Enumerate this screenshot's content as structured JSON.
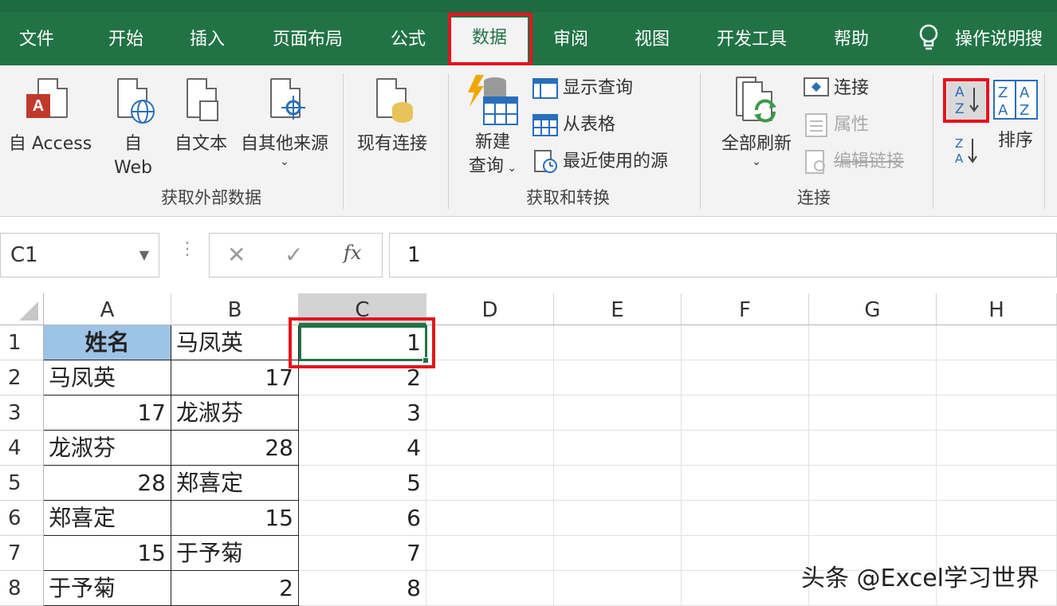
{
  "tabs": [
    "文件",
    "开始",
    "插入",
    "页面布局",
    "公式",
    "数据",
    "审阅",
    "视图",
    "开发工具",
    "帮助"
  ],
  "active_tab": "数据",
  "tell_me": "操作说明搜",
  "ribbon": {
    "from_access": "自 Access",
    "from_web_1": "自",
    "from_web_2": "Web",
    "from_text": "自文本",
    "from_other": "自其他来源",
    "existing_conn": "现有连接",
    "group_get_external": "获取外部数据",
    "new_query_1": "新建",
    "new_query_2": "查询",
    "show_queries": "显示查询",
    "from_table": "从表格",
    "recent_sources": "最近使用的源",
    "group_get_transform": "获取和转换",
    "refresh_all": "全部刷新",
    "connections": "连接",
    "properties": "属性",
    "edit_links": "编辑链接",
    "group_connections": "连接",
    "sort": "排序",
    "sort_asc_icon": "A\nZ",
    "sort_desc_icon": "Z\nA"
  },
  "namebox": "C1",
  "formula_value": "1",
  "columns": [
    "A",
    "B",
    "C",
    "D",
    "E",
    "F",
    "G",
    "H"
  ],
  "rows": [
    "1",
    "2",
    "3",
    "4",
    "5",
    "6",
    "7",
    "8"
  ],
  "cells": {
    "A1": "姓名",
    "B1": "马凤英",
    "C1": "1",
    "A2": "马凤英",
    "B2": "17",
    "C2": "2",
    "A3": "17",
    "B3": "龙淑芬",
    "C3": "3",
    "A4": "龙淑芬",
    "B4": "28",
    "C4": "4",
    "A5": "28",
    "B5": "郑喜定",
    "C5": "5",
    "A6": "郑喜定",
    "B6": "15",
    "C6": "6",
    "A7": "15",
    "B7": "于予菊",
    "C7": "7",
    "A8": "于予菊",
    "B8": "2",
    "C8": "8"
  },
  "watermark": "头条 @Excel学习世界",
  "colors": {
    "accent": "#217346",
    "highlight": "#e5131d",
    "header_fill": "#9dc3e6"
  }
}
